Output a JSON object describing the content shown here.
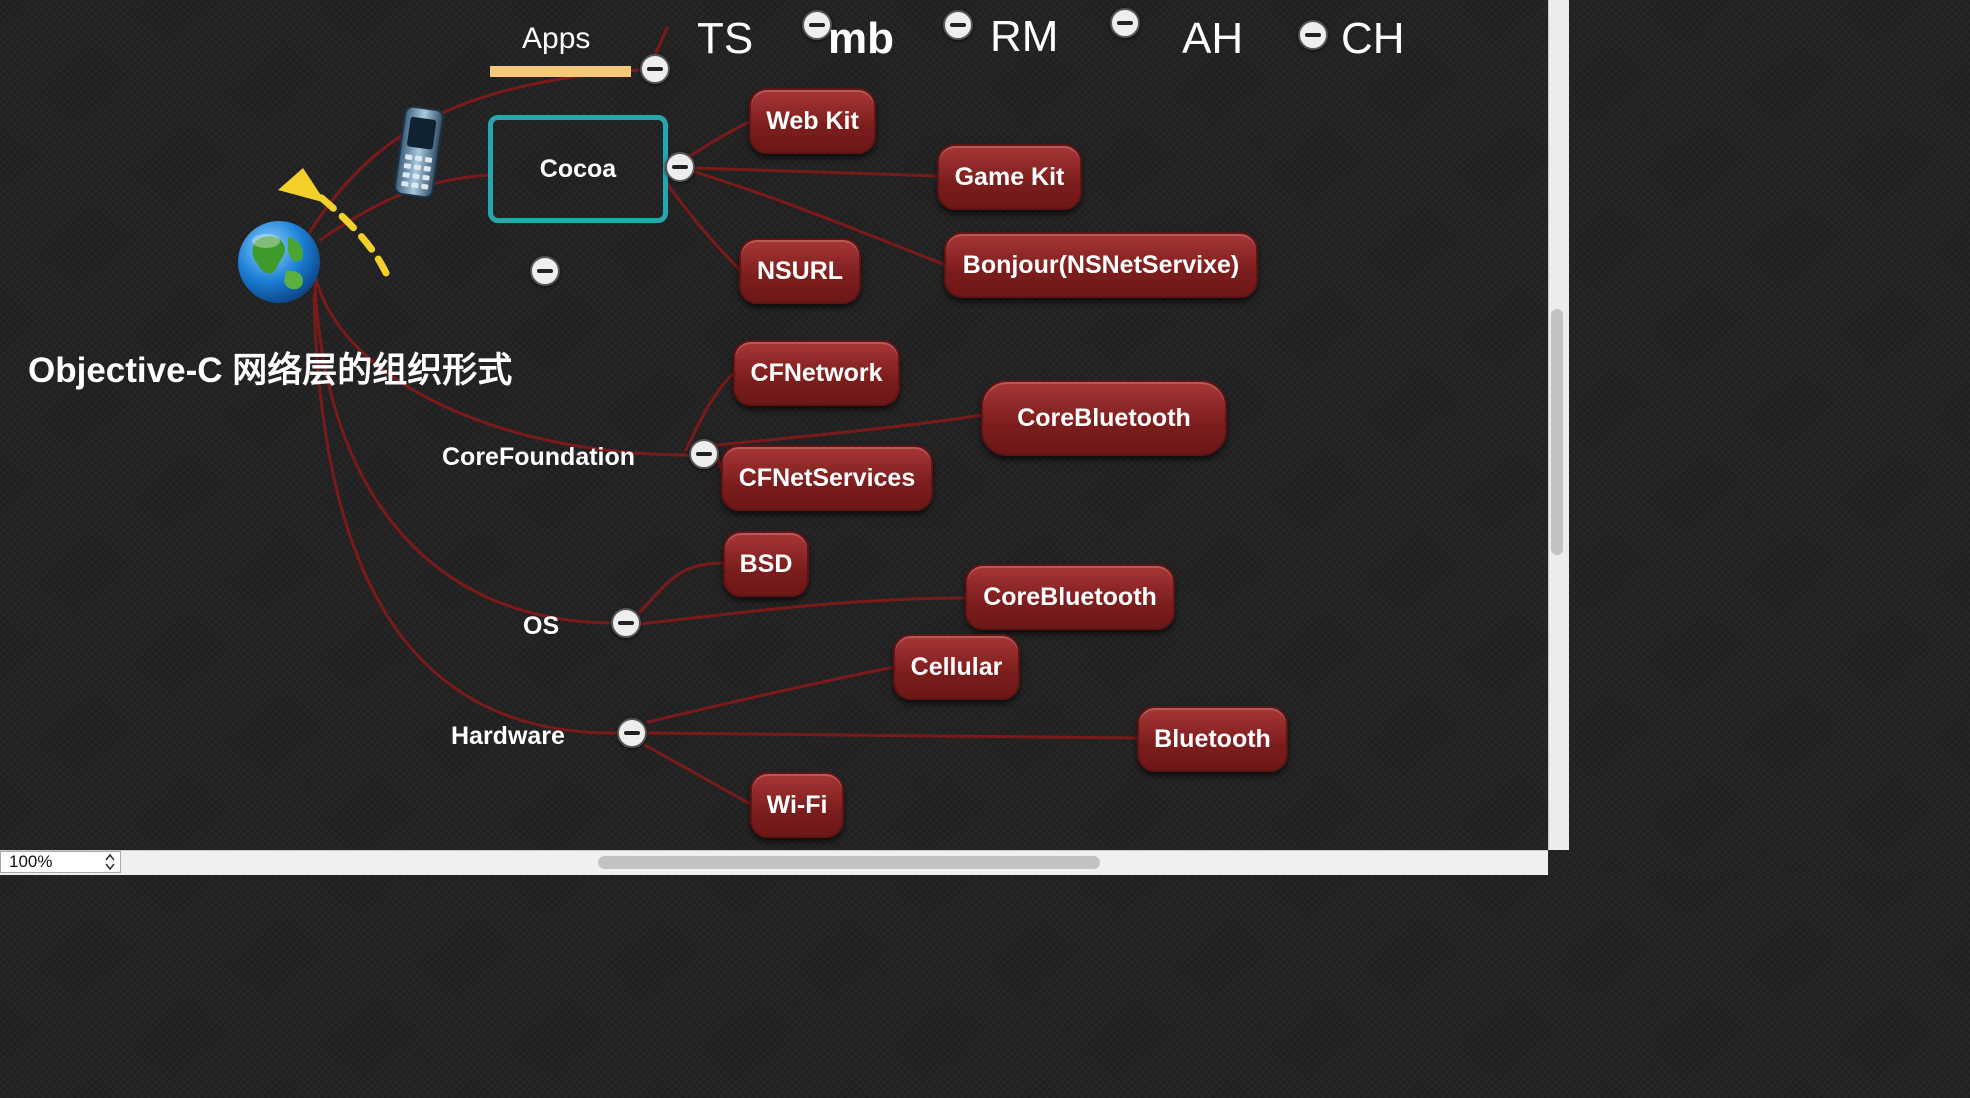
{
  "header": {
    "items": [
      {
        "label": "TS",
        "collapse": false
      },
      {
        "label": "mb",
        "collapse": true
      },
      {
        "label": "RM",
        "collapse": true
      },
      {
        "label": "",
        "collapse": true
      },
      {
        "label": "AH",
        "collapse": false
      },
      {
        "label": "CH",
        "collapse": true
      }
    ]
  },
  "map": {
    "title": "Objective-C 网络层的组织形式",
    "apps_label": "Apps",
    "cocoa": {
      "label": "Cocoa",
      "children": [
        "Web Kit",
        "Game Kit",
        "Bonjour(NSNetServixe)",
        "NSURL"
      ]
    },
    "core_foundation": {
      "label": "CoreFoundation",
      "children": [
        "CFNetwork",
        "CoreBluetooth",
        "CFNetServices"
      ]
    },
    "os": {
      "label": "OS",
      "children": [
        "BSD",
        "CoreBluetooth"
      ]
    },
    "hardware": {
      "label": "Hardware",
      "children": [
        "Cellular",
        "Bluetooth",
        "Wi-Fi"
      ]
    }
  },
  "icons": {
    "root": "globe-icon",
    "apps": "mobile-phone-icon",
    "annotation": "dashed-arrow-annotation",
    "collapse": "collapse-minus-icon"
  },
  "colors": {
    "background": "#232323",
    "node_fill": "#7c1d1d",
    "connector": "#7a1a1a",
    "cocoa_outline": "#26a6ad",
    "apps_underline": "#f6c87a",
    "annotation_arrow": "#f3d12a"
  },
  "status": {
    "zoom": "100%"
  }
}
